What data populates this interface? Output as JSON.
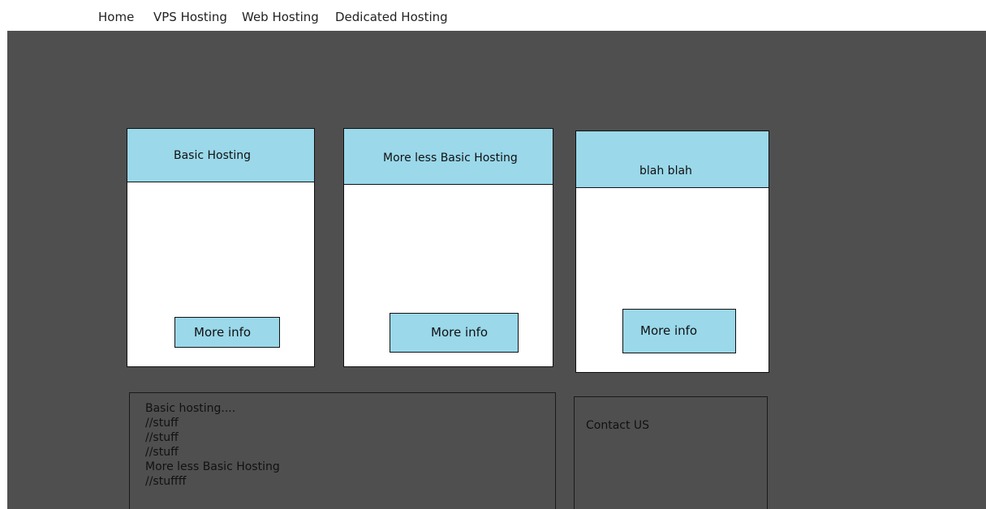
{
  "nav": {
    "items": [
      {
        "label": "Home"
      },
      {
        "label": "VPS Hosting"
      },
      {
        "label": "Web Hosting"
      },
      {
        "label": "Dedicated Hosting"
      }
    ]
  },
  "cards": [
    {
      "title": "Basic Hosting",
      "button": "More info"
    },
    {
      "title": "More less Basic Hosting",
      "button": "More info"
    },
    {
      "title": "blah blah",
      "button": "More info"
    }
  ],
  "description_panel": {
    "lines": [
      "Basic hosting....",
      "//stuff",
      "//stuff",
      "//stuff",
      "More less Basic Hosting",
      "//stuffff"
    ]
  },
  "contact_panel": {
    "title": "Contact US"
  },
  "colors": {
    "page_background": "#4f4f4f",
    "card_accent": "#9ad8ea",
    "card_background": "#ffffff",
    "border": "#111111"
  }
}
